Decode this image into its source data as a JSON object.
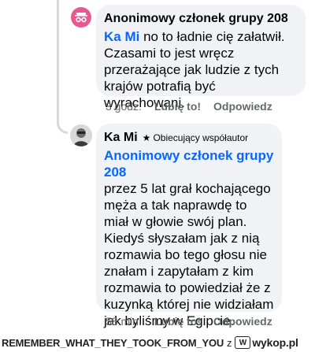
{
  "comments": [
    {
      "author": "Anonimowy członek grupy 208",
      "mention": "Ka Mi",
      "text": " no to ładnie cię załatwił. Czasami to jest wręcz przerażające jak ludzie z tych krajów potrafią być wyrachowani.",
      "time": "3 godz.",
      "like_label": "Lubię to!",
      "reply_label": "Odpowiedz",
      "avatar_icon": "incognito-icon"
    },
    {
      "author": "Ka Mi",
      "badge": "Obiecujący współautor",
      "badge_icon": "star-icon",
      "mention": "Anonimowy członek grupy 208",
      "text": "przez 5 lat grał kochającego męża a tak naprawdę to miał w głowie swój plan. Kiedyś słyszałam jak z nią rozmawia bo tego głosu nie znałam i zapytałam z kim rozmawia to powiedział że z kuzynką której nie widziałam jak byliśmy w Egipcie.",
      "time": "58 min.",
      "like_label": "Lubię to!",
      "reply_label": "Odpowiedz"
    }
  ],
  "footer": {
    "tag": "REMEMBER_WHAT_THEY_TOOK_FROM_YOU",
    "connector": "z",
    "logo": "wykop-logo-icon",
    "site": "wykop.pl"
  },
  "colors": {
    "mention": "#0866ff",
    "bubble": "#f0f2f5",
    "meta": "#65676b",
    "anon_avatar": "#e85a8f"
  }
}
